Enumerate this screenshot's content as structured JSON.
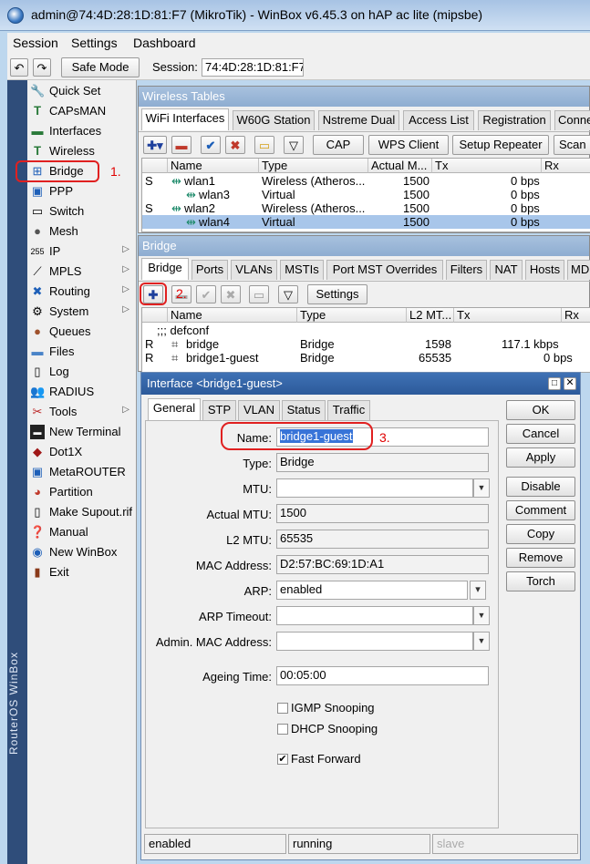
{
  "window": {
    "title": "admin@74:4D:28:1D:81:F7 (MikroTik) - WinBox v6.45.3 on hAP ac lite (mipsbe)"
  },
  "menubar": [
    "Session",
    "Settings",
    "Dashboard"
  ],
  "toolbar": {
    "undo_icon": "undo-icon",
    "redo_icon": "redo-icon",
    "safe_mode": "Safe Mode",
    "session_label": "Session:",
    "session_value": "74:4D:28:1D:81:F7"
  },
  "sidebar_vertical_text": "RouterOS WinBox",
  "menu": [
    {
      "label": "Quick Set",
      "icon": "quick-set-icon"
    },
    {
      "label": "CAPsMAN",
      "icon": "capsman-icon"
    },
    {
      "label": "Interfaces",
      "icon": "interfaces-icon"
    },
    {
      "label": "Wireless",
      "icon": "wireless-icon"
    },
    {
      "label": "Bridge",
      "icon": "bridge-icon"
    },
    {
      "label": "PPP",
      "icon": "ppp-icon"
    },
    {
      "label": "Switch",
      "icon": "switch-icon"
    },
    {
      "label": "Mesh",
      "icon": "mesh-icon"
    },
    {
      "label": "IP",
      "icon": "ip-icon"
    },
    {
      "label": "MPLS",
      "icon": "mpls-icon"
    },
    {
      "label": "Routing",
      "icon": "routing-icon"
    },
    {
      "label": "System",
      "icon": "system-icon"
    },
    {
      "label": "Queues",
      "icon": "queues-icon"
    },
    {
      "label": "Files",
      "icon": "files-icon"
    },
    {
      "label": "Log",
      "icon": "log-icon"
    },
    {
      "label": "RADIUS",
      "icon": "radius-icon"
    },
    {
      "label": "Tools",
      "icon": "tools-icon"
    },
    {
      "label": "New Terminal",
      "icon": "terminal-icon"
    },
    {
      "label": "Dot1X",
      "icon": "dot1x-icon"
    },
    {
      "label": "MetaROUTER",
      "icon": "metarouter-icon"
    },
    {
      "label": "Partition",
      "icon": "partition-icon"
    },
    {
      "label": "Make Supout.rif",
      "icon": "supout-icon"
    },
    {
      "label": "Manual",
      "icon": "manual-icon"
    },
    {
      "label": "New WinBox",
      "icon": "new-winbox-icon"
    },
    {
      "label": "Exit",
      "icon": "exit-icon"
    }
  ],
  "annotations": {
    "step1": "1.",
    "step2": "2.",
    "step3": "3."
  },
  "wireless": {
    "title": "Wireless Tables",
    "tabs": [
      "WiFi Interfaces",
      "W60G Station",
      "Nstreme Dual",
      "Access List",
      "Registration",
      "Conne"
    ],
    "buttons": {
      "cap": "CAP",
      "wps": "WPS Client",
      "setup": "Setup Repeater",
      "scan": "Scan"
    },
    "columns": [
      "Name",
      "Type",
      "Actual M...",
      "Tx",
      "Rx"
    ],
    "rows": [
      {
        "flag": "S",
        "name": "wlan1",
        "type": "Wireless (Atheros...",
        "mtu": "1500",
        "tx": "0 bps"
      },
      {
        "flag": "",
        "name": "wlan3",
        "type": "Virtual",
        "mtu": "1500",
        "tx": "0 bps"
      },
      {
        "flag": "S",
        "name": "wlan2",
        "type": "Wireless (Atheros...",
        "mtu": "1500",
        "tx": "0 bps"
      },
      {
        "flag": "",
        "name": "wlan4",
        "type": "Virtual",
        "mtu": "1500",
        "tx": "0 bps"
      }
    ]
  },
  "bridge": {
    "title": "Bridge",
    "tabs": [
      "Bridge",
      "Ports",
      "VLANs",
      "MSTIs",
      "Port MST Overrides",
      "Filters",
      "NAT",
      "Hosts",
      "MD"
    ],
    "settings": "Settings",
    "columns": [
      "Name",
      "Type",
      "L2 MT...",
      "Tx",
      "Rx"
    ],
    "comment": ";;; defconf",
    "rows": [
      {
        "flag": "R",
        "name": "bridge",
        "type": "Bridge",
        "l2mtu": "1598",
        "tx": "117.1 kbps"
      },
      {
        "flag": "R",
        "name": "bridge1-guest",
        "type": "Bridge",
        "l2mtu": "65535",
        "tx": "0 bps"
      }
    ]
  },
  "dialog": {
    "title": "Interface <bridge1-guest>",
    "tabs": [
      "General",
      "STP",
      "VLAN",
      "Status",
      "Traffic"
    ],
    "fields": {
      "name_label": "Name:",
      "name": "bridge1-guest",
      "type_label": "Type:",
      "type": "Bridge",
      "mtu_label": "MTU:",
      "mtu": "",
      "actual_mtu_label": "Actual MTU:",
      "actual_mtu": "1500",
      "l2mtu_label": "L2 MTU:",
      "l2mtu": "65535",
      "mac_label": "MAC Address:",
      "mac": "D2:57:BC:69:1D:A1",
      "arp_label": "ARP:",
      "arp": "enabled",
      "arp_timeout_label": "ARP Timeout:",
      "arp_timeout": "",
      "admin_mac_label": "Admin. MAC Address:",
      "admin_mac": "",
      "ageing_label": "Ageing Time:",
      "ageing": "00:05:00"
    },
    "checkboxes": [
      {
        "label": "IGMP Snooping",
        "checked": false
      },
      {
        "label": "DHCP Snooping",
        "checked": false
      },
      {
        "label": "Fast Forward",
        "checked": true
      }
    ],
    "buttons": [
      "OK",
      "Cancel",
      "Apply",
      "Disable",
      "Comment",
      "Copy",
      "Remove",
      "Torch"
    ],
    "status": [
      "enabled",
      "running",
      "slave"
    ]
  },
  "colors": {
    "annotation": "#e02020",
    "selection": "#a8c6ea",
    "titlebar": "#2c5a9a"
  }
}
